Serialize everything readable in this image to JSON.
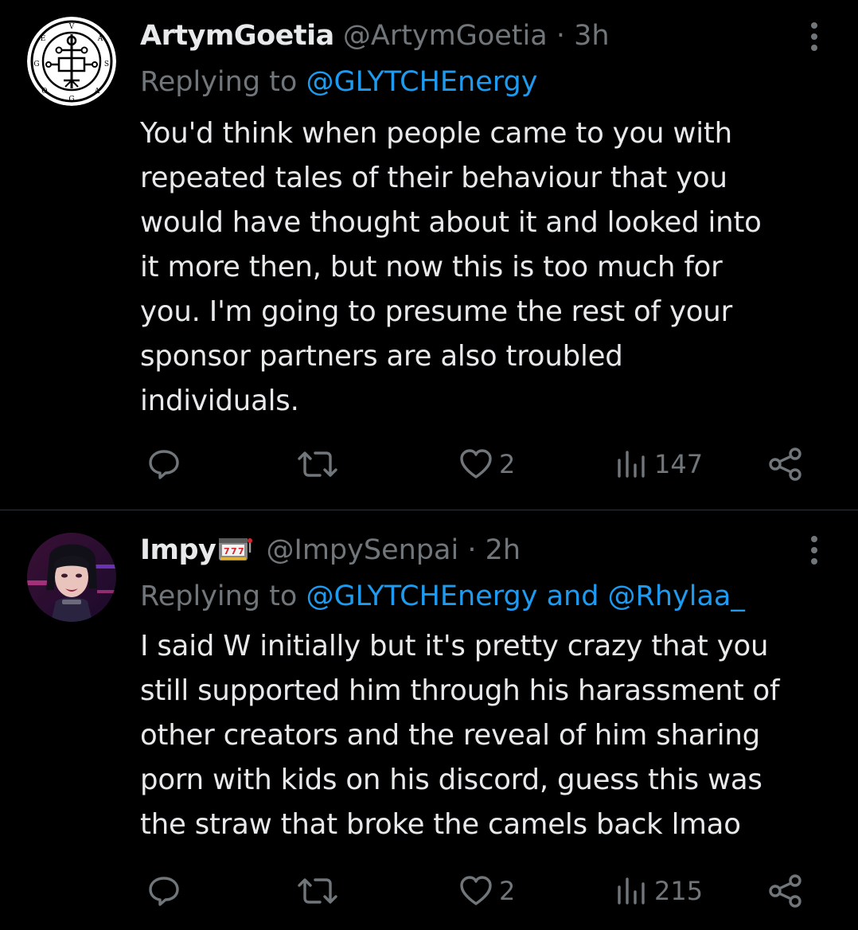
{
  "tweets": [
    {
      "display_name": "ArtymGoetia",
      "handle": "@ArtymGoetia",
      "separator": "·",
      "time": "3h",
      "replying_prefix": "Replying to ",
      "replying_to": "@GLYTCHEnergy",
      "replying_and": "",
      "replying_to_2": "",
      "text": "You'd think when people came to you with\nrepeated tales of their behaviour that you\nwould have thought about it and looked into\nit more then, but now this is too much for\nyou. I'm going to presume the rest of your\nsponsor partners are also troubled\nindividuals.",
      "avatar_icon": "occult-sigil-avatar",
      "badge_icon": "",
      "likes": "2",
      "views": "147"
    },
    {
      "display_name": "Impy",
      "handle": "@ImpySenpai",
      "separator": "·",
      "time": "2h",
      "replying_prefix": "Replying to ",
      "replying_to": "@GLYTCHEnergy",
      "replying_and": " and ",
      "replying_to_2": "@Rhylaa_",
      "text": "I said W initially but it's pretty crazy that you\nstill supported him through his harassment of\nother creators and the reveal of him sharing\nporn with kids on his discord, guess this was\nthe straw that broke the camels back lmao",
      "avatar_icon": "anime-character-avatar",
      "badge_icon": "slot-machine-emoji",
      "likes": "2",
      "views": "215"
    }
  ],
  "colors": {
    "background": "#000000",
    "text_primary": "#e7e9ea",
    "text_secondary": "#71767b",
    "link": "#1d9bf0",
    "divider": "#2f3336"
  }
}
